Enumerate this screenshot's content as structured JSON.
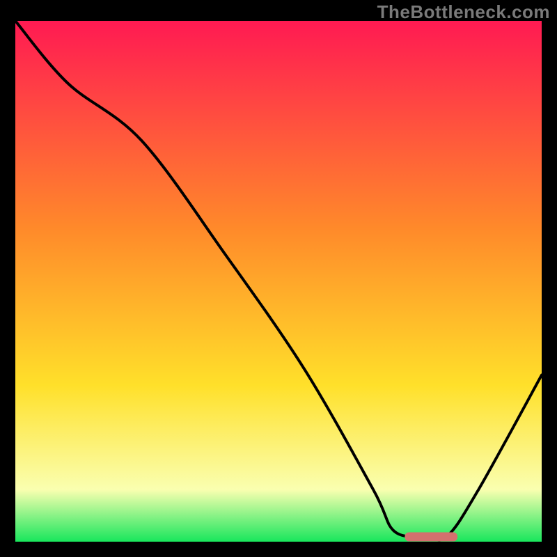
{
  "watermark": "TheBottleneck.com",
  "colors": {
    "gradient_top": "#ff1a52",
    "gradient_mid1": "#ff8a2a",
    "gradient_mid2": "#ffe02a",
    "gradient_mid3": "#faffb0",
    "gradient_bottom": "#18e65c",
    "line": "#000000",
    "marker": "#d4706e",
    "background": "#000000"
  },
  "chart_data": {
    "type": "line",
    "title": "",
    "xlabel": "",
    "ylabel": "",
    "xlim": [
      0,
      100
    ],
    "ylim": [
      0,
      100
    ],
    "grid": false,
    "legend": false,
    "series": [
      {
        "name": "bottleneck-curve",
        "x": [
          0,
          10,
          24,
          40,
          55,
          68,
          72,
          78,
          82,
          88,
          100
        ],
        "y": [
          100,
          88,
          77,
          55,
          33,
          10,
          2,
          1,
          1,
          10,
          32
        ]
      }
    ],
    "marker": {
      "name": "optimal-range",
      "x_start": 74,
      "x_end": 84,
      "y": 1
    }
  }
}
